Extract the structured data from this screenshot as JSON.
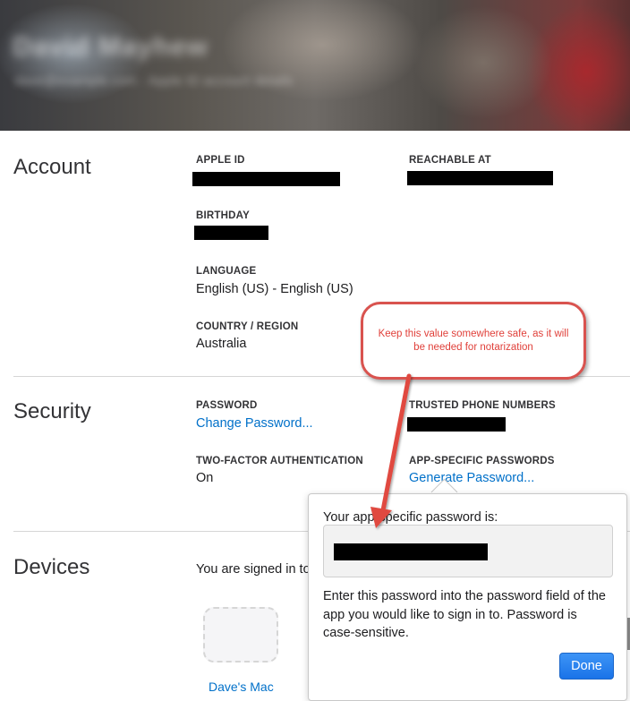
{
  "header": {
    "name": "David Mayhew",
    "subtitle": "dave@example.com · Apple ID account details"
  },
  "account": {
    "title": "Account",
    "apple_id_label": "APPLE ID",
    "reachable_label": "REACHABLE AT",
    "birthday_label": "BIRTHDAY",
    "language_label": "LANGUAGE",
    "language_value": "English (US) - English (US)",
    "country_label": "COUNTRY / REGION",
    "country_value": "Australia"
  },
  "security": {
    "title": "Security",
    "password_label": "PASSWORD",
    "change_password": "Change Password...",
    "trusted_label": "TRUSTED PHONE NUMBERS",
    "two_factor_label": "TWO-FACTOR AUTHENTICATION",
    "two_factor_value": "On",
    "app_specific_label": "APP-SPECIFIC PASSWORDS",
    "generate_password": "Generate Password..."
  },
  "devices": {
    "title": "Devices",
    "signed_in_text": "You are signed in to",
    "device_name": "Dave's Mac"
  },
  "popover": {
    "heading": "Your app-specific password is:",
    "body": "Enter this password into the password field of the app you would like to sign in to. Password is case-sensitive.",
    "done": "Done"
  },
  "annotation": {
    "text": "Keep this value somewhere safe, as it will be needed for notarization",
    "color": "#e0403a"
  },
  "colors": {
    "link": "#0070c9",
    "button": "#1a73e8"
  }
}
